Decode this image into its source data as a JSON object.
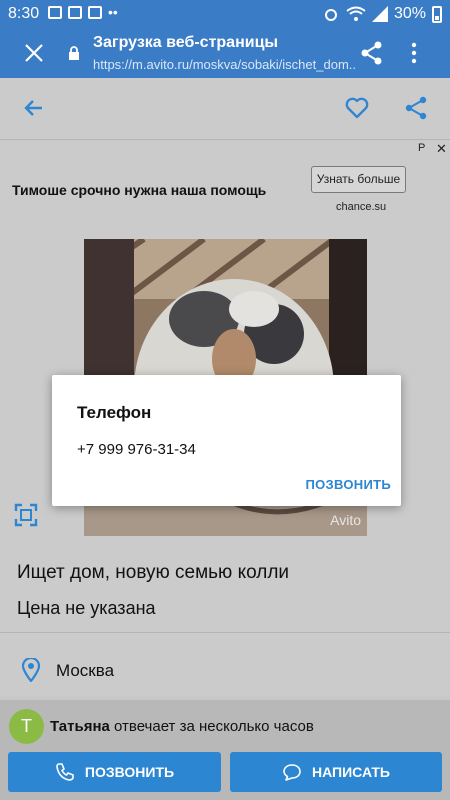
{
  "status_bar": {
    "time": "8:30",
    "battery": "30%"
  },
  "browser": {
    "title": "Загрузка веб-страницы",
    "url": "https://m.avito.ru/moskva/sobaki/ischet_dom..."
  },
  "ad": {
    "text": "Тимоше срочно нужна наша помощь",
    "button": "Узнать больше",
    "domain": "chance.su",
    "mark": "Р",
    "close": "✕"
  },
  "photo": {
    "watermark": "Avito"
  },
  "listing": {
    "title": "Ищет дом, новую семью колли",
    "price": "Цена не указана",
    "city": "Москва"
  },
  "seller": {
    "initial": "Т",
    "name": "Татьяна",
    "response": " отвечает за несколько часов"
  },
  "actions": {
    "call": "ПОЗВОНИТЬ",
    "write": "НАПИСАТЬ"
  },
  "dialog": {
    "title": "Телефон",
    "phone": "+7 999 976-31-34",
    "action": "ПОЗВОНИТЬ"
  },
  "colors": {
    "accent": "#2d86d2",
    "toolbar": "#3a7cc6",
    "avatar": "#8bbb45"
  }
}
